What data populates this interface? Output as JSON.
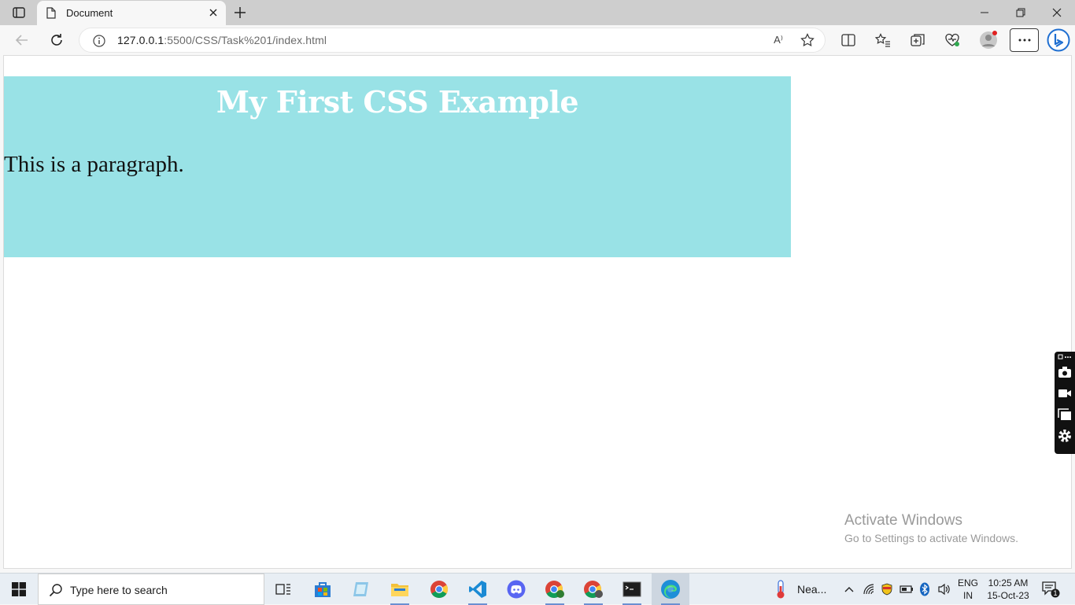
{
  "browser": {
    "tab_title": "Document",
    "url_host": "127.0.0.1",
    "url_rest": ":5500/CSS/Task%201/index.html",
    "read_aloud": "A⁾"
  },
  "page": {
    "heading": "My First CSS Example",
    "paragraph": "This is a paragraph.",
    "box_color": "#99e2e6"
  },
  "watermark": {
    "line1": "Activate Windows",
    "line2": "Go to Settings to activate Windows."
  },
  "taskbar": {
    "search_placeholder": "Type here to search",
    "weather": "Nea...",
    "lang_line1": "ENG",
    "lang_line2": "IN",
    "time": "10:25 AM",
    "date": "15-Oct-23",
    "notification_count": "1"
  }
}
